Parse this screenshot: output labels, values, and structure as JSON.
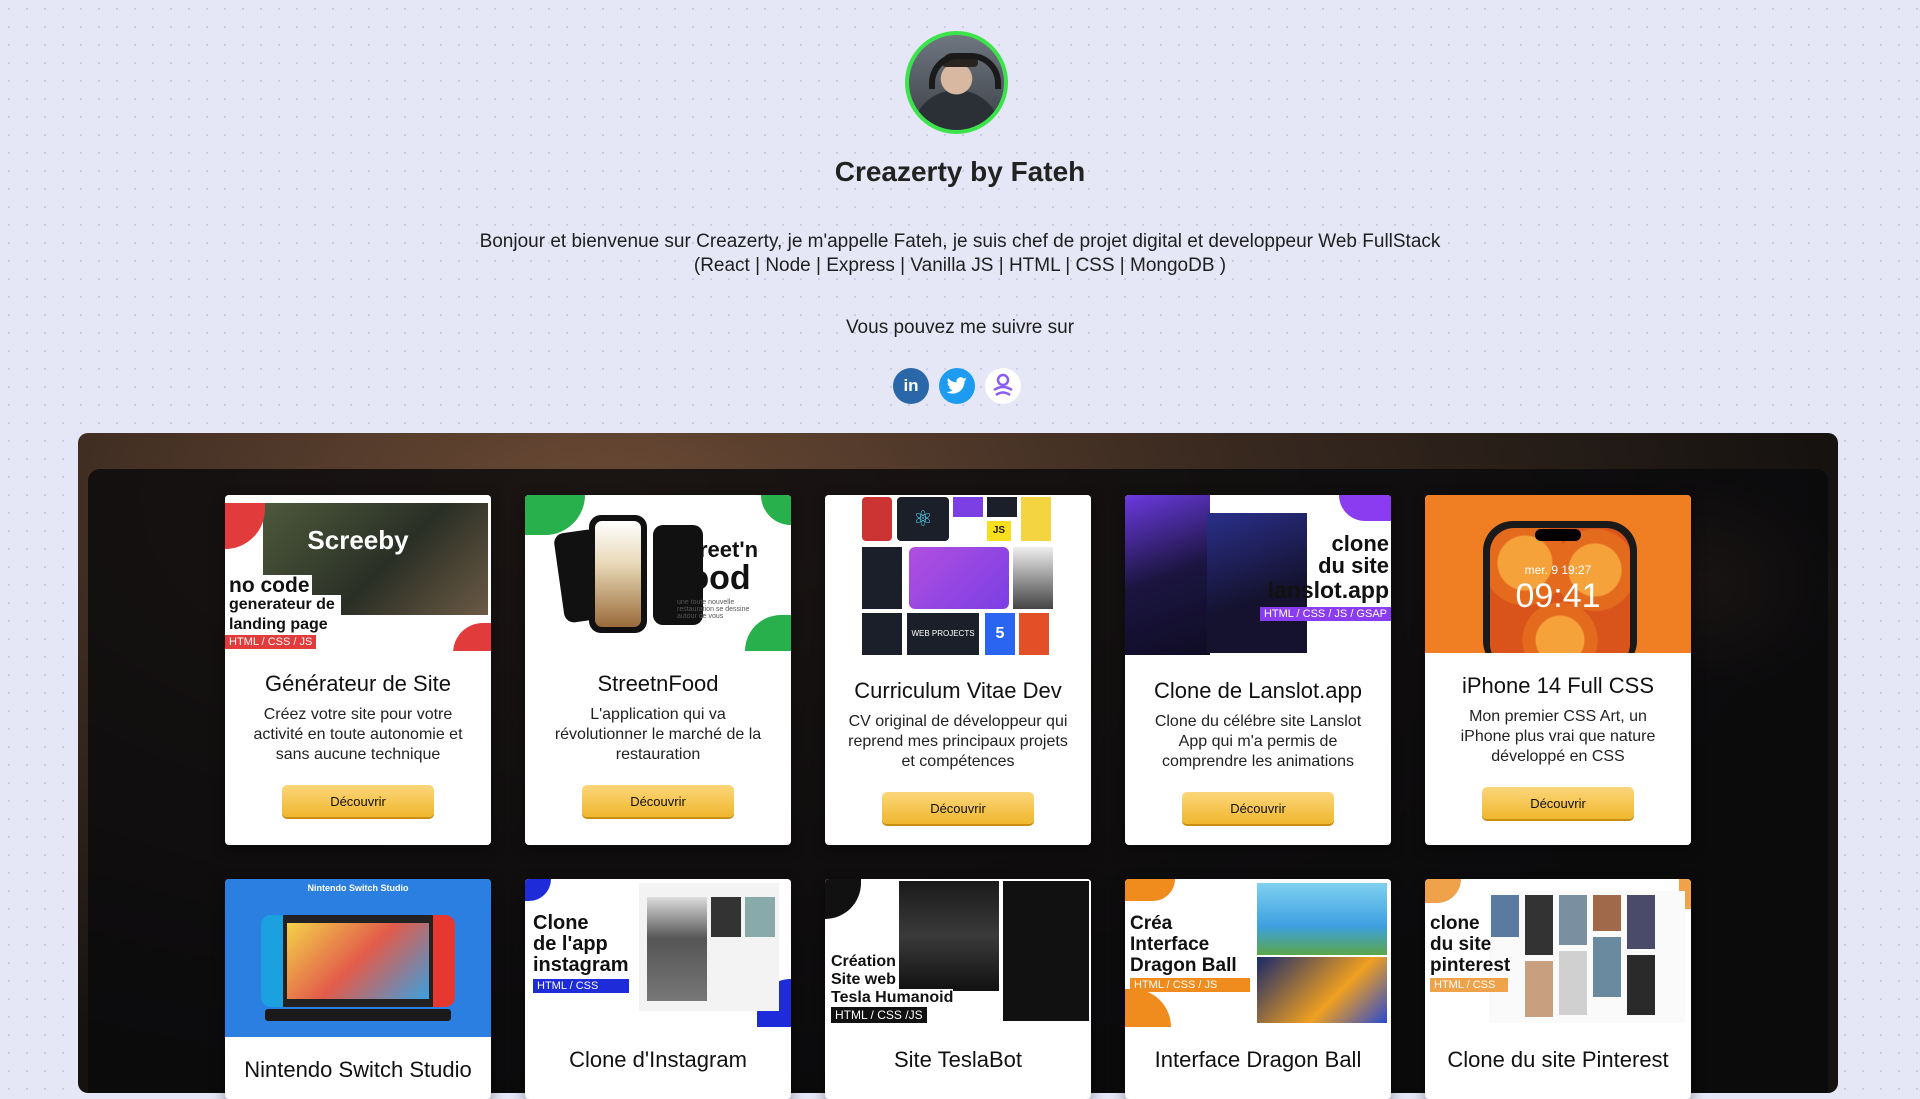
{
  "profile": {
    "name": "Creazerty by Fateh",
    "intro_line1": "Bonjour et bienvenue sur Creazerty, je m'appelle Fateh, je suis chef de projet digital et developpeur Web FullStack",
    "intro_line2": "(React | Node | Express | Vanilla JS | HTML | CSS | MongoDB )",
    "follow": "Vous pouvez me suivre sur"
  },
  "socials": [
    {
      "icon": "linkedin-icon",
      "label": "in"
    },
    {
      "icon": "twitter-icon"
    },
    {
      "icon": "linktree-icon"
    }
  ],
  "projects": [
    {
      "title": "Générateur de Site",
      "desc": "Créez votre site pour votre activité en toute autonomie et sans aucune technique",
      "button": "Découvrir",
      "thumb": {
        "heading": "Screeby",
        "big": "no code",
        "sub": "generateur de landing page",
        "tag": "HTML / CSS / JS"
      }
    },
    {
      "title": "StreetnFood",
      "desc": "L'application qui va révolutionner le marché de la restauration",
      "button": "Découvrir",
      "thumb": {
        "heading": "Street'n",
        "big": "food",
        "sub": "une toute nouvelle restauration se dessine autour de vous"
      }
    },
    {
      "title": "Curriculum Vitae Dev",
      "desc": "CV original de développeur qui reprend mes principaux projets et compétences",
      "button": "Découvrir",
      "thumb": {
        "logo_js": "JS",
        "tiles": "WEB PROJECTS",
        "badge": "5"
      }
    },
    {
      "title": "Clone de Lanslot.app",
      "desc": "Clone du célébre site Lanslot App qui m'a permis de comprendre les animations",
      "button": "Découvrir",
      "thumb": {
        "line1": "clone",
        "line2": "du site",
        "line3": "lanslot.app",
        "tag": "HTML / CSS / JS / GSAP"
      }
    },
    {
      "title": "iPhone 14 Full CSS",
      "desc": "Mon premier CSS Art, un iPhone plus vrai que nature développé en CSS",
      "button": "Découvrir",
      "thumb": {
        "date": "mer. 9 19:27",
        "time": "09:41"
      }
    },
    {
      "title": "Nintendo Switch Studio",
      "thumb": {
        "heading": "Nintendo Switch Studio"
      }
    },
    {
      "title": "Clone d'Instagram",
      "thumb": {
        "line1": "Clone",
        "line2": "de l'app",
        "line3": "instagram",
        "tag": "HTML / CSS"
      }
    },
    {
      "title": "Site TeslaBot",
      "thumb": {
        "line1": "Création",
        "line2": "Site web",
        "line3": "Tesla Humanoid",
        "tag": "HTML / CSS /JS"
      }
    },
    {
      "title": "Interface Dragon Ball",
      "thumb": {
        "line1": "Créa",
        "line2": "Interface",
        "line3": "Dragon Ball",
        "tag": "HTML / CSS / JS"
      }
    },
    {
      "title": "Clone du site Pinterest",
      "thumb": {
        "line1": "clone",
        "line2": "du site",
        "line3": "pinterest",
        "tag": "HTML / CSS"
      }
    }
  ],
  "colors": {
    "accent_button": "#f0b72e",
    "avatar_ring": "#3ce34a",
    "background": "#e5e6f6"
  }
}
